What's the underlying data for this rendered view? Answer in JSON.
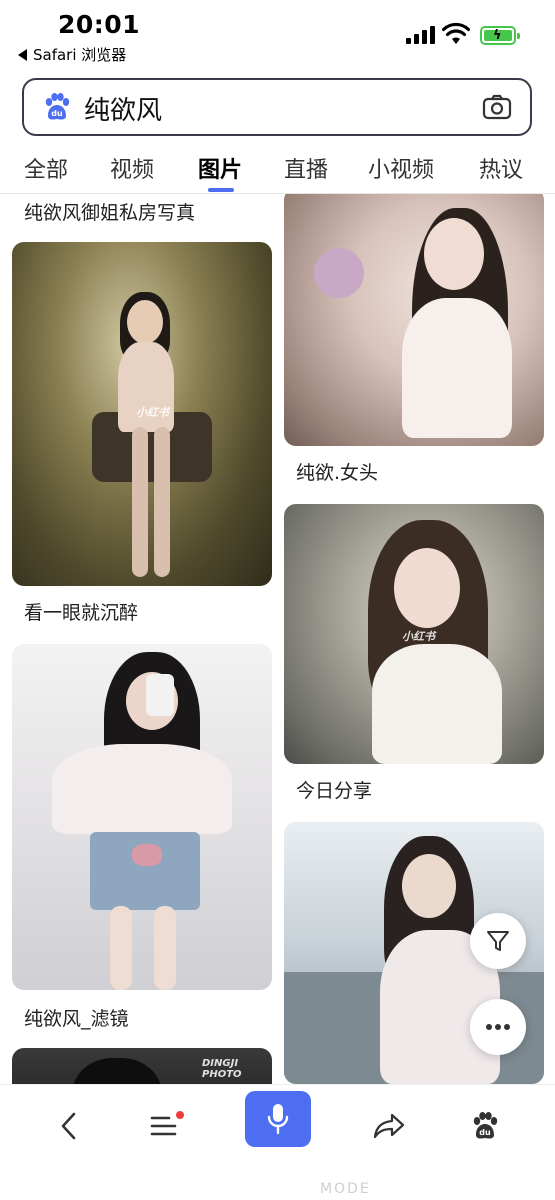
{
  "status_bar": {
    "time": "20:01",
    "back_app": "Safari 浏览器",
    "battery_color": "#46c64a"
  },
  "search": {
    "query": "纯欲风",
    "left_icon": "baidu-paw-icon",
    "right_icon": "camera-icon"
  },
  "tabs": [
    {
      "label": "全部"
    },
    {
      "label": "视频"
    },
    {
      "label": "图片",
      "active": true
    },
    {
      "label": "直播"
    },
    {
      "label": "小视频"
    },
    {
      "label": "热议"
    }
  ],
  "feed": {
    "left": [
      {
        "caption": "纯欲风御姐私房写真"
      },
      {
        "caption": "看一眼就沉醉",
        "watermark": "小红书"
      },
      {
        "caption": "纯欲风_滤镜"
      },
      {
        "watermark": "DINGJI PHOTO"
      }
    ],
    "right": [
      {
        "caption": "纯欲.女头"
      },
      {
        "caption": "今日分享",
        "watermark": "小红书"
      },
      {
        "caption": ""
      }
    ]
  },
  "floating": {
    "filter_icon": "filter-icon",
    "more_icon": "more-dots-icon"
  },
  "bottom_bar": {
    "items": [
      "back-arrow-icon",
      "menu-list-icon",
      "microphone-icon",
      "share-icon",
      "baidu-paw-icon"
    ],
    "accent": "#4e6ef2",
    "home_indicator": "MODE"
  }
}
